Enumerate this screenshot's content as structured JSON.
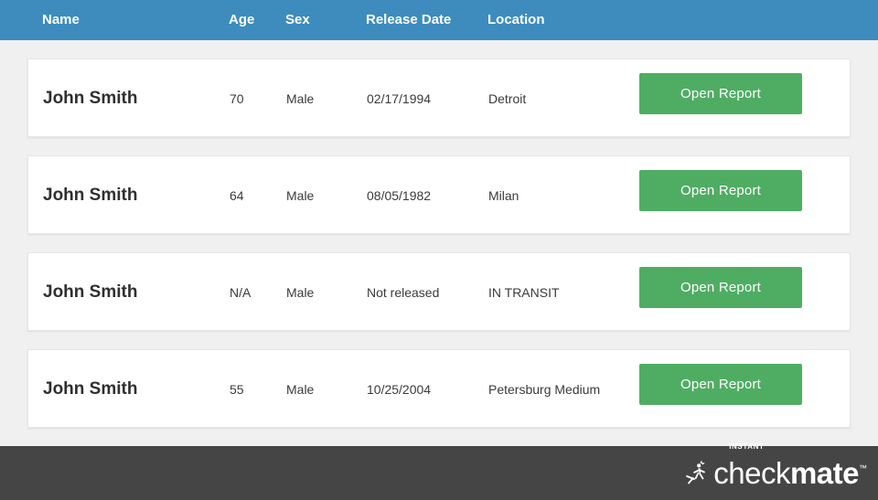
{
  "colors": {
    "header_blue": "#3d8cbd",
    "button_green": "#4fad63",
    "footer_dark": "#454545",
    "page_background": "#f0f0f0",
    "card_white": "#ffffff",
    "text_dark": "#3a3a3a"
  },
  "table": {
    "columns": [
      {
        "key": "name",
        "label": "Name"
      },
      {
        "key": "age",
        "label": "Age"
      },
      {
        "key": "sex",
        "label": "Sex"
      },
      {
        "key": "release_date",
        "label": "Release Date"
      },
      {
        "key": "location",
        "label": "Location"
      }
    ],
    "rows": [
      {
        "name": "John Smith",
        "age": "70",
        "sex": "Male",
        "release_date": "02/17/1994",
        "location": "Detroit",
        "action_label": "Open Report"
      },
      {
        "name": "John Smith",
        "age": "64",
        "sex": "Male",
        "release_date": "08/05/1982",
        "location": "Milan",
        "action_label": "Open Report"
      },
      {
        "name": "John Smith",
        "age": "N/A",
        "sex": "Male",
        "release_date": "Not released",
        "location": "IN TRANSIT",
        "action_label": "Open Report"
      },
      {
        "name": "John Smith",
        "age": "55",
        "sex": "Male",
        "release_date": "10/25/2004",
        "location": "Petersburg Medium",
        "action_label": "Open Report"
      }
    ]
  },
  "footer": {
    "logo": {
      "mark_icon": "starburst-person-icon",
      "tagline": "INSTANT",
      "word_light": "check",
      "word_bold": "mate",
      "trademark": "™"
    }
  }
}
